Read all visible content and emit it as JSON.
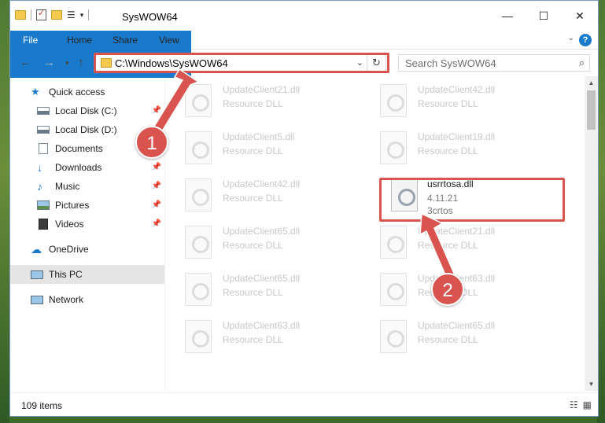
{
  "window": {
    "title": "SysWOW64"
  },
  "ribbon": {
    "tabs": [
      "File",
      "Home",
      "Share",
      "View"
    ]
  },
  "nav": {
    "address": "C:\\Windows\\SysWOW64",
    "search_placeholder": "Search SysWOW64"
  },
  "sidebar": {
    "items": [
      {
        "label": "Quick access",
        "icon": "star-icon",
        "pinned": false
      },
      {
        "label": "Local Disk (C:)",
        "icon": "drive-icon",
        "pinned": true
      },
      {
        "label": "Local Disk (D:)",
        "icon": "drive-icon",
        "pinned": false
      },
      {
        "label": "Documents",
        "icon": "documents-icon",
        "pinned": true
      },
      {
        "label": "Downloads",
        "icon": "download-icon",
        "pinned": true
      },
      {
        "label": "Music",
        "icon": "music-icon",
        "pinned": true
      },
      {
        "label": "Pictures",
        "icon": "pictures-icon",
        "pinned": true
      },
      {
        "label": "Videos",
        "icon": "videos-icon",
        "pinned": true
      },
      {
        "label": "OneDrive",
        "icon": "cloud-icon",
        "pinned": false
      },
      {
        "label": "This PC",
        "icon": "computer-icon",
        "pinned": false,
        "selected": true
      },
      {
        "label": "Network",
        "icon": "network-icon",
        "pinned": false
      }
    ]
  },
  "files": [
    {
      "name": "UpdateClient21.dll",
      "sub": "Resource DLL"
    },
    {
      "name": "UpdateClient42.dll",
      "sub": "Resource DLL"
    },
    {
      "name": "UpdateClient5.dll",
      "sub": "Resource DLL"
    },
    {
      "name": "UpdateClient19.dll",
      "sub": "Resource DLL"
    },
    {
      "name": "UpdateClient42.dll",
      "sub": "Resource DLL"
    },
    {
      "name": "usrrtosa.dll",
      "sub": "4.11.21",
      "sub2": "3crtos",
      "highlighted": true
    },
    {
      "name": "UpdateClient65.dll",
      "sub": "Resource DLL"
    },
    {
      "name": "UpdateClient21.dll",
      "sub": "Resource DLL"
    },
    {
      "name": "UpdateClient65.dll",
      "sub": "Resource DLL"
    },
    {
      "name": "UpdateClient63.dll",
      "sub": "Resource DLL"
    },
    {
      "name": "UpdateClient63.dll",
      "sub": "Resource DLL"
    },
    {
      "name": "UpdateClient65.dll",
      "sub": "Resource DLL"
    }
  ],
  "status": {
    "count": "109 items"
  },
  "callouts": {
    "one": "1",
    "two": "2"
  },
  "colors": {
    "accent": "#1979ca",
    "highlight": "#d9534f"
  }
}
